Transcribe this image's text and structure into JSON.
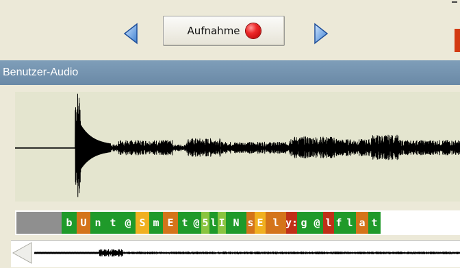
{
  "toolbar": {
    "record_label": "Aufnahme",
    "prev_icon": "triangle-left-icon",
    "next_icon": "triangle-right-icon",
    "record_icon": "red-record-dot-icon"
  },
  "panel": {
    "title": "Benutzer-Audio"
  },
  "phonemes": {
    "lead_segment_color": "#8f8f8f",
    "segments": [
      {
        "label": "b",
        "color": "#1f9a2a"
      },
      {
        "label": "U",
        "color": "#d4741a"
      },
      {
        "label": "n",
        "color": "#1f9a2a"
      },
      {
        "label": "t",
        "color": "#1f9a2a"
      },
      {
        "label": "@",
        "color": "#1f9a2a"
      },
      {
        "label": "S",
        "color": "#f0b020"
      },
      {
        "label": "m",
        "color": "#1f9a2a"
      },
      {
        "label": "E",
        "color": "#d4741a"
      },
      {
        "label": "t",
        "color": "#1f9a2a"
      },
      {
        "label": "@",
        "color": "#1f9a2a"
      },
      {
        "label": "5",
        "color": "#8ac440"
      },
      {
        "label": "l",
        "color": "#1f9a2a"
      },
      {
        "label": "I",
        "color": "#8ac440"
      },
      {
        "label": "N",
        "color": "#1f9a2a"
      },
      {
        "label": "s",
        "color": "#d4741a"
      },
      {
        "label": "E",
        "color": "#f0b020"
      },
      {
        "label": "l",
        "color": "#d4741a"
      },
      {
        "label": "y:",
        "color": "#c03018"
      },
      {
        "label": "g",
        "color": "#1f9a2a"
      },
      {
        "label": "@",
        "color": "#1f9a2a"
      },
      {
        "label": "l",
        "color": "#c03018"
      },
      {
        "label": "f",
        "color": "#1f9a2a"
      },
      {
        "label": "l",
        "color": "#1f9a2a"
      },
      {
        "label": "a",
        "color": "#d4741a"
      },
      {
        "label": "t",
        "color": "#1f9a2a"
      }
    ]
  },
  "colors": {
    "waveform_bg": "#e4e5cf",
    "header_bg": "#7392ae",
    "window_bg": "#ece9d8"
  }
}
